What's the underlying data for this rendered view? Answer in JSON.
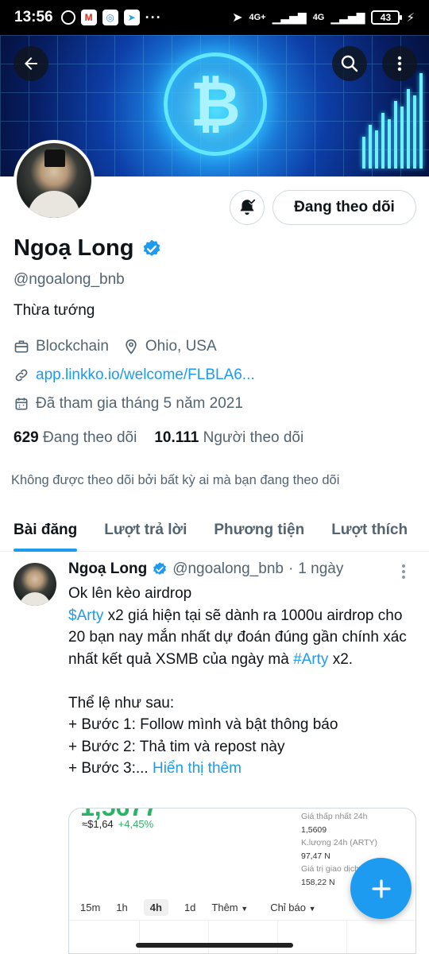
{
  "status_bar": {
    "time": "13:56",
    "signal_left": "4G+",
    "signal_right": "4G",
    "battery": "43"
  },
  "profile": {
    "name": "Ngoạ Long",
    "handle": "@ngoalong_bnb",
    "bio": "Thừa tướng",
    "category": "Blockchain",
    "location": "Ohio, USA",
    "link": "app.linkko.io/welcome/FLBLA6...",
    "joined": "Đã tham gia tháng 5 năm 2021",
    "following_count": "629",
    "following_label": "Đang theo dõi",
    "followers_count": "10.111",
    "followers_label": "Người theo dõi",
    "not_followed_note": "Không được theo dõi bởi bất kỳ ai mà bạn đang theo dõi",
    "follow_button": "Đang theo dõi"
  },
  "tabs": [
    {
      "label": "Bài đăng",
      "active": true
    },
    {
      "label": "Lượt trả lời",
      "active": false
    },
    {
      "label": "Phương tiện",
      "active": false
    },
    {
      "label": "Lượt thích",
      "active": false
    }
  ],
  "tweet": {
    "name": "Ngoạ Long",
    "handle": "@ngoalong_bnb",
    "separator": "·",
    "time": "1 ngày",
    "line1": "Ok lên kèo airdrop",
    "cashtag": "$Arty",
    "line2": " x2 giá hiện tại sẽ dành ra 1000u airdrop cho 20 bạn nay mắn nhất dự đoán đúng gần chính xác nhất kết quả XSMB của ngày mà ",
    "hashtag": "#Arty",
    "line3": " x2.",
    "rules_title": "Thể lệ như sau:",
    "step1": "+ Bước 1: Follow mình và bật thông báo",
    "step2": "+ Bước 2: Thả tim và repost này",
    "step3": "+ Bước 3:...",
    "show_more": "Hiển thị thêm"
  },
  "card": {
    "big_price": "1,5677",
    "usd_price": "≈$1,64",
    "change": "+4,45%",
    "low_label": "Giá thấp nhất 24h",
    "low_value": "1,5609",
    "volume_label": "K.lượng 24h (ARTY)",
    "volume_value": "97,47 N",
    "value_label": "Giá trị giao dịch...",
    "value_value": "158,22 N",
    "timeframes": [
      "15m",
      "1h",
      "4h",
      "1d"
    ],
    "selected_timeframe": "4h",
    "more_label": "Thêm",
    "indicator_label": "Chỉ báo"
  },
  "colors": {
    "accent": "#1d9bf0",
    "text": "#0f1419",
    "secondary": "#536471",
    "positive": "#28b463"
  },
  "icons": [
    "back-arrow-icon",
    "search-icon",
    "more-vertical-icon",
    "bell-icon",
    "verified-badge-icon",
    "briefcase-icon",
    "location-pin-icon",
    "link-icon",
    "calendar-icon",
    "plus-icon"
  ]
}
